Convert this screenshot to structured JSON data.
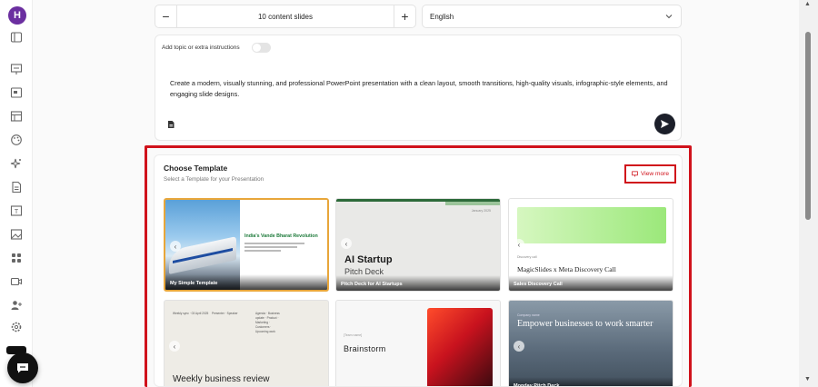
{
  "sidebar": {
    "avatar_initial": "H",
    "icons": [
      "sidebar-toggle-icon",
      "presentation-icon",
      "slides-icon",
      "layout-icon",
      "palette-icon",
      "sparkle-icon",
      "document-icon",
      "text-icon",
      "image-icon",
      "apps-icon",
      "video-icon",
      "add-user-icon",
      "settings-icon"
    ]
  },
  "slides_stepper": {
    "minus": "−",
    "value": "10 content slides",
    "plus": "+"
  },
  "language_select": {
    "value": "English"
  },
  "prompt": {
    "topic_label": "Add topic or extra instructions",
    "text": "Create a modern, visually stunning, and professional PowerPoint presentation with a clean layout, smooth transitions, high-quality visuals, infographic-style elements, and engaging slide designs."
  },
  "templates": {
    "title": "Choose Template",
    "subtitle": "Select a Template for your Presentation",
    "view_more": "View more",
    "items": [
      {
        "caption": "My Simple Template",
        "heading": "India's Vande Bharat Revolution"
      },
      {
        "caption": "Pitch Deck for AI Startups",
        "heading": "AI Startup",
        "sub": "Pitch Deck",
        "date": "January 2025"
      },
      {
        "caption": "Sales Discovery Call",
        "heading": "MagicSlides x Meta Discovery Call",
        "sub": "Discovery call"
      },
      {
        "caption": "",
        "heading": "Weekly business review",
        "col1": "Weekly sync · 03 April 2025",
        "col2": "Presenter · Speaker",
        "col3": "Agenda · Business update · Product · Marketing · Customers · Upcoming work"
      },
      {
        "caption": "",
        "heading": "Brainstorm",
        "sub": "[Team name]"
      },
      {
        "caption": "Monday Pitch Deck",
        "heading": "Empower businesses to work smarter",
        "sub": "Company name"
      }
    ]
  },
  "colors": {
    "highlight": "#d0121b",
    "avatar": "#6b2fa0",
    "send": "#1c1f2a"
  }
}
